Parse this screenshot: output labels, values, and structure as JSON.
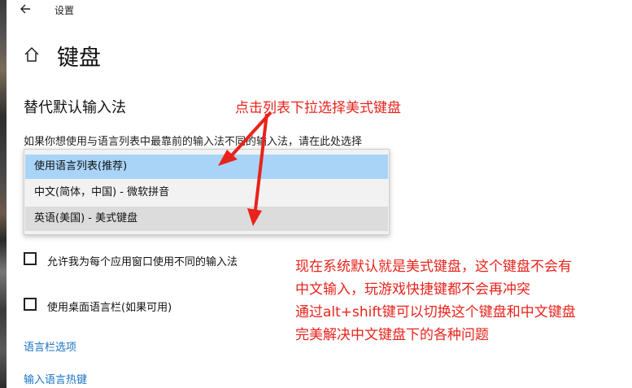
{
  "window": {
    "title": "设置"
  },
  "page": {
    "title": "键盘",
    "section_title": "替代默认输入法",
    "description": "如果你想使用与语言列表中最靠前的输入法不同的输入法，请在此处选择"
  },
  "dropdown": {
    "options": [
      "使用语言列表(推荐)",
      "中文(简体，中国) - 微软拼音",
      "英语(美国) - 美式键盘"
    ],
    "highlighted": "使用语言列表(推荐)"
  },
  "checkboxes": [
    {
      "label": "允许我为每个应用窗口使用不同的输入法",
      "checked": false
    },
    {
      "label": "使用桌面语言栏(如果可用)",
      "checked": false
    }
  ],
  "links": [
    "语言栏选项",
    "输入语言热键"
  ],
  "annotations": {
    "top": "点击列表下拉选择美式键盘",
    "lines": [
      "现在系统默认就是美式键盘，这个键盘不会有",
      "中文输入，玩游戏快捷键都不会再冲突",
      "通过alt+shift键可以切换这个键盘和中文键盘",
      "完美解决中文键盘下的各种问题"
    ]
  },
  "icons": {
    "back": "back-arrow-icon",
    "home": "home-icon"
  },
  "colors": {
    "highlight": "#a9d4f7",
    "link": "#1a74c4",
    "annotation": "#e8231b"
  }
}
